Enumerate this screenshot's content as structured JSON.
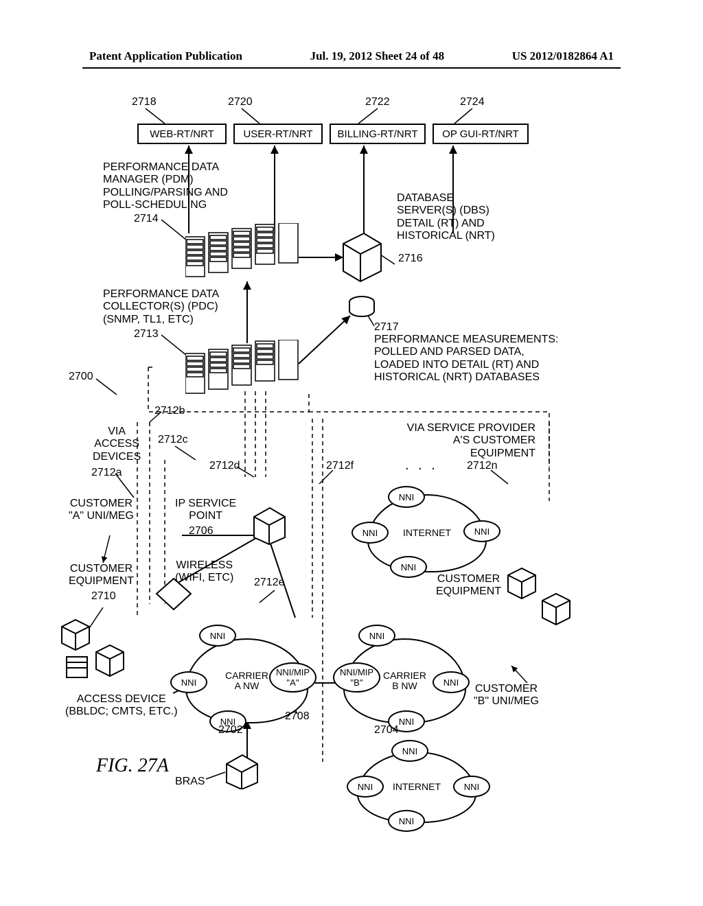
{
  "header": {
    "left": "Patent Application Publication",
    "center": "Jul. 19, 2012  Sheet 24 of 48",
    "right": "US 2012/0182864 A1"
  },
  "top_row": {
    "boxes": [
      {
        "ref": "2718",
        "label": "WEB-RT/NRT"
      },
      {
        "ref": "2720",
        "label": "USER-RT/NRT"
      },
      {
        "ref": "2722",
        "label": "BILLING-RT/NRT"
      },
      {
        "ref": "2724",
        "label": "OP GUI-RT/NRT"
      }
    ]
  },
  "pdm_block": {
    "text": "PERFORMANCE DATA\nMANAGER (PDM)\nPOLLING/PARSING AND\nPOLL-SCHEDULING",
    "ref": "2714"
  },
  "dbs_block": {
    "text": "DATABASE\nSERVER(S) (DBS)\nDETAIL (RT) AND\nHISTORICAL (NRT)",
    "ref": "2716"
  },
  "pdc_block": {
    "text": "PERFORMANCE DATA\nCOLLECTOR(S) (PDC)\n(SNMP, TL1, ETC)",
    "ref": "2713"
  },
  "perf_meas": {
    "ref": "2717",
    "text": "PERFORMANCE MEASUREMENTS:\nPOLLED AND PARSED DATA,\nLOADED INTO DETAIL (RT) AND\nHISTORICAL (NRT) DATABASES"
  },
  "root_ref": "2700",
  "via_access": "VIA\nACCESS\nDEVICES",
  "via_sp": "VIA SERVICE PROVIDER\nA'S CUSTOMER\nEQUIPMENT",
  "refs_mid": {
    "r2712a": "2712a",
    "r2712b": "2712b",
    "r2712c": "2712c",
    "r2712d": "2712d",
    "r2712e": "2712e",
    "r2712f": "2712f",
    "r2712n": "2712n"
  },
  "ip_service_point": {
    "label": "IP SERVICE\nPOINT",
    "ref": "2706"
  },
  "wireless": "WIRELESS\n(WIFI, ETC)",
  "customer_a": "CUSTOMER\n\"A\" UNI/MEG",
  "customer_b": "CUSTOMER\n\"B\" UNI/MEG",
  "customer_equipment_a": {
    "label": "CUSTOMER\nEQUIPMENT",
    "ref": "2710"
  },
  "customer_equipment_b": "CUSTOMER\nEQUIPMENT",
  "access_device": "ACCESS DEVICE\n(BBLDC; CMTS, ETC.)",
  "bras": "BRAS",
  "carrier_a": {
    "label": "CARRIER\nA NW",
    "ref": "2702"
  },
  "carrier_b": {
    "label": "CARRIER\nB NW",
    "ref": "2704"
  },
  "nni": "NNI",
  "nni_mip_a": "NNI/MIP\n\"A\"",
  "nni_mip_b": "NNI/MIP\n\"B\"",
  "internet": "INTERNET",
  "ref2708": "2708",
  "ellipsis": ". . .",
  "figure_caption": "FIG. 27A"
}
